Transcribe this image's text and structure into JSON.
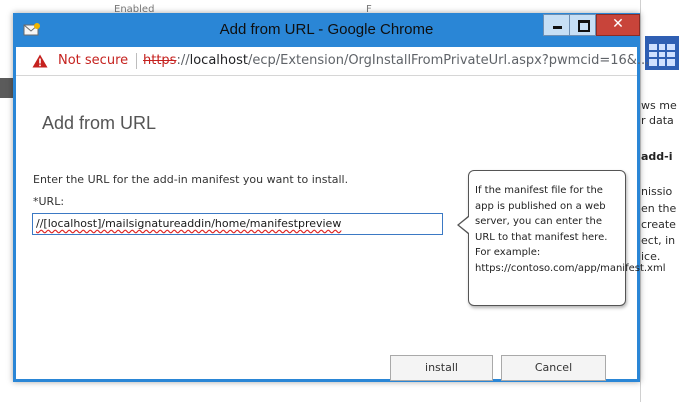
{
  "background": {
    "fragment_top_left": "Enabled",
    "fragment_top_right": "F",
    "right_panel_lines": [
      "ws me",
      "r data",
      "add-i",
      "nissio",
      "en the",
      "create",
      "ect, in",
      "ice."
    ]
  },
  "window": {
    "title": "Add from URL - Google Chrome",
    "close_glyph": "✕"
  },
  "address_bar": {
    "security_label": "Not secure",
    "url_scheme": "https",
    "url_separator": "://",
    "url_host": "localhost",
    "url_path": "/ecp/Extension/OrgInstallFromPrivateUrl.aspx?pwmcid=16&..."
  },
  "dialog": {
    "title": "Add from URL",
    "instruction": "Enter the URL for the add-in manifest you want to install.",
    "url_label": "*URL:",
    "url_value": "//[localhost]/mailsignatureaddin/home/manifestpreview",
    "help_text": "If the manifest file for the app is published on a web server, you can enter the URL to that manifest here. For example: https://contoso.com/app/manifest.xml",
    "install_button": "install",
    "cancel_button": "Cancel"
  },
  "colors": {
    "title_bar": "#2a86d6",
    "warning": "#c5221f",
    "input_border": "#3b79c4"
  },
  "icons": [
    "app-icon",
    "warning-icon",
    "minimize-icon",
    "maximize-icon",
    "close-icon",
    "calendar-icon"
  ]
}
